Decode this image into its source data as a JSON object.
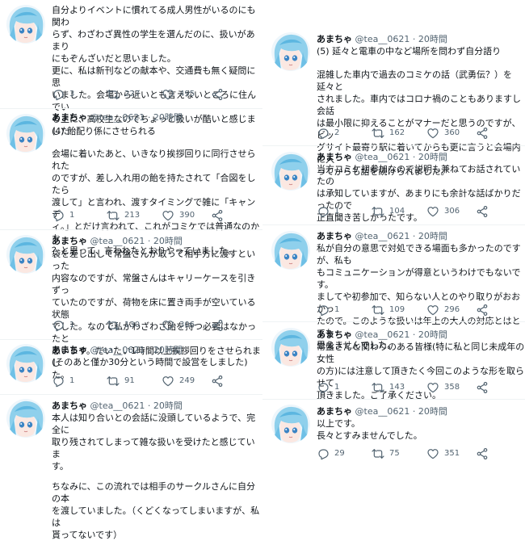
{
  "user": {
    "name": "あまちゃ",
    "handle": "@tea__0621",
    "dot": "·",
    "time": "20時間"
  },
  "colors": {
    "text": "#0f1419",
    "muted": "#536471",
    "divider": "#eff3f4",
    "hair": "#8fd0ec"
  },
  "icons": [
    "reply-icon",
    "retweet-icon",
    "like-icon",
    "share-icon",
    "avatar-illustration"
  ],
  "left_tweets": [
    {
      "lines": [
        "自分よりイベントに慣れてる成人男性がいるのにも関わ",
        "らず、わざわざ異性の学生を選んだのに、扱いがあまり",
        "にもぞんざいだと思いました。",
        "更に、私は新刊などの献本や、交通費も無く疑問に思",
        "いました。会場から近いとも言えないところに住んでい",
        "る上に、高校生なのでちょっと扱いが酷いと感じました"
      ],
      "replies": "3",
      "retweets": "227",
      "likes": "495"
    },
    {
      "lines": [
        "(4) 飴配り係にさせられる",
        "",
        "会場に着いたあと、いきなり挨拶回りに同行させられた",
        "のですが、差し入れ用の飴を持たされて「合図をしたら",
        "渡して」と言われ、渡すタイミングで雑に「キャンデ",
        "ィ。」とだけ言われて、これがコミケでは普通なのかな",
        "？と思って、言われたとおりやっていました。"
      ],
      "replies": "1",
      "retweets": "213",
      "likes": "390"
    },
    {
      "lines": [
        "袋を差し出して常盤さんが取って相手方に渡すといった",
        "内容なのですが、常盤さんはキャリーケースを引きずっ",
        "ていたのですが、荷物を床に置き両手が空いている状態",
        "でした。なので私がわざわざ飴を持つ必要はなかったと",
        "思います。だいたい1時間以上挨拶回りをさせられまし",
        "た。"
      ],
      "replies": "1",
      "retweets": "130",
      "likes": "306"
    },
    {
      "lines": [
        "(そのあと僅か30分という時間で設営をしました)"
      ],
      "replies": "1",
      "retweets": "91",
      "likes": "249"
    },
    {
      "lines": [
        "本人は知り合いとの会話に没頭しているようで、完全に",
        "取り残されてしまって雑な扱いを受けたと感じていま",
        "す。",
        "",
        "ちなみに、この流れでは相手のサークルさんに自分の本",
        "を渡していました。（くどくなってしまいますが、私は",
        "貰ってないです）"
      ]
    }
  ],
  "right_tweets": [
    {
      "lines": [
        "(5) 延々と電車の中など場所を問わず自分語り",
        "",
        "混雑した車内で過去のコミケの話（武勇伝？）を延々と",
        "されました。車内ではコロナ禍のこともありますし会話",
        "は最小限に抑えることがマナーだと思うのですが、ビッ",
        "グサイト最寄り駅に着いてからも更に言うと会場内に入",
        "ってからも話を続けられました。"
      ],
      "replies": "2",
      "retweets": "162",
      "likes": "360"
    },
    {
      "lines": [
        "当方コミケ初参加なので説明も兼ねてお話されていたの",
        "は承知していますが、あまりにも余計な話ばかりだったので",
        "正直聞き苦しかったです。"
      ],
      "replies": "1",
      "retweets": "104",
      "likes": "306"
    },
    {
      "lines": [
        "私が自分の意思で対処できる場面も多かったのですが、私も",
        "もコミュニケーションが得意というわけでもないです。",
        "ましてや初参加で、知らない人とのやり取りがおおかっ",
        "たので。このような扱いは年上の大人の対応とはとても",
        "思えませんでした。"
      ],
      "replies": "1",
      "retweets": "109",
      "likes": "296"
    },
    {
      "lines": [
        "常盤さんと関わりのある皆様(特に私と同じ未成年の女性",
        "の方)には注意して頂きたく今回このような形を取らせて",
        "頂きました。ご了承ください。"
      ],
      "replies": "1",
      "retweets": "143",
      "likes": "358"
    },
    {
      "lines": [
        "以上です。",
        "長々とすみませんでした。"
      ],
      "replies": "29",
      "retweets": "75",
      "likes": "351"
    }
  ]
}
